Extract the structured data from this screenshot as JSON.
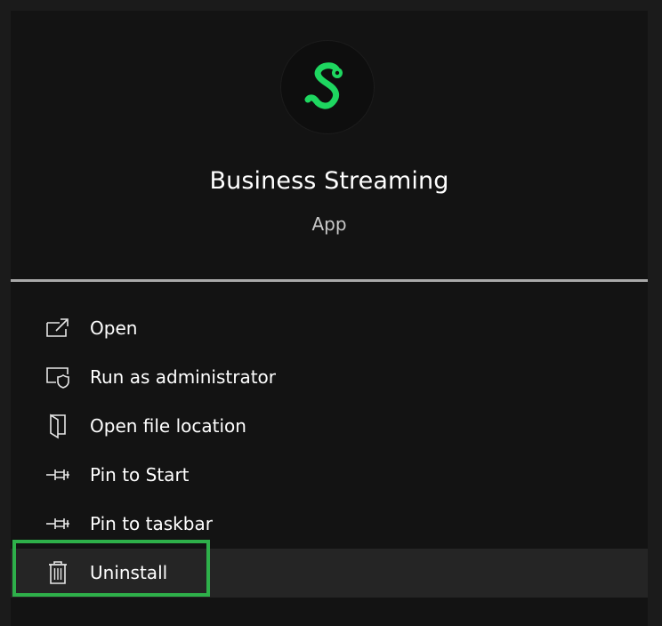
{
  "app": {
    "name": "Business Streaming",
    "type": "App",
    "icon": "spotify-s-logo-icon",
    "accent_color": "#1ed760"
  },
  "menu": {
    "items": [
      {
        "label": "Open",
        "icon": "open-external-icon"
      },
      {
        "label": "Run as administrator",
        "icon": "admin-shield-icon"
      },
      {
        "label": "Open file location",
        "icon": "folder-door-icon"
      },
      {
        "label": "Pin to Start",
        "icon": "pin-icon"
      },
      {
        "label": "Pin to taskbar",
        "icon": "pin-icon"
      },
      {
        "label": "Uninstall",
        "icon": "trash-icon"
      }
    ]
  },
  "colors": {
    "highlight_border": "#2eb04a",
    "panel_background": "#131313",
    "divider": "#a9a9a9"
  }
}
